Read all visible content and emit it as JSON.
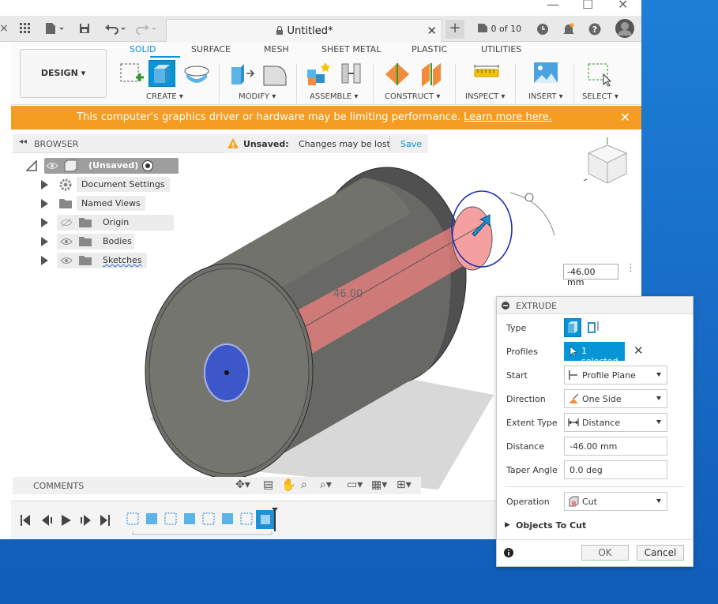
{
  "window": {
    "document_title": "Untitled*",
    "counter": "0 of 10",
    "os_controls": [
      "—",
      "☐",
      "✕"
    ]
  },
  "toolbar": {
    "design_label": "DESIGN ▾",
    "tabs": [
      {
        "label": "SOLID",
        "active": true
      },
      {
        "label": "SURFACE"
      },
      {
        "label": "MESH"
      },
      {
        "label": "SHEET METAL"
      },
      {
        "label": "PLASTIC"
      },
      {
        "label": "UTILITIES"
      }
    ],
    "groups": [
      "CREATE ▾",
      "MODIFY ▾",
      "ASSEMBLE ▾",
      "CONSTRUCT ▾",
      "INSPECT ▾",
      "INSERT ▾",
      "SELECT ▾"
    ]
  },
  "banner": {
    "message": "This computer's graphics driver or hardware may be limiting performance.",
    "link": "Learn more here.",
    "close": "✕"
  },
  "browser": {
    "title": "BROWSER",
    "unsaved_label": "Unsaved:",
    "unsaved_message": "Changes may be lost",
    "save_label": "Save",
    "root": "(Unsaved)",
    "items": [
      {
        "label": "Document Settings",
        "icon": "gear-icon"
      },
      {
        "label": "Named Views",
        "icon": "folder-icon"
      },
      {
        "label": "Origin",
        "icon": "folder-icon",
        "eye": "hidden"
      },
      {
        "label": "Bodies",
        "icon": "folder-icon",
        "eye": "visible"
      },
      {
        "label": "Sketches",
        "icon": "folder-icon",
        "eye": "visible"
      }
    ]
  },
  "viewport": {
    "dimension_label": "46.00",
    "distance_input": "-46.00 mm"
  },
  "extrude": {
    "title": "EXTRUDE",
    "rows": {
      "type_label": "Type",
      "profiles_label": "Profiles",
      "profiles_value": "1 selected",
      "start_label": "Start",
      "start_value": "Profile Plane",
      "direction_label": "Direction",
      "direction_value": "One Side",
      "extent_label": "Extent Type",
      "extent_value": "Distance",
      "distance_label": "Distance",
      "distance_value": "-46.00 mm",
      "taper_label": "Taper Angle",
      "taper_value": "0.0 deg",
      "operation_label": "Operation",
      "operation_value": "Cut",
      "objects_label": "Objects To Cut"
    },
    "ok_label": "OK",
    "cancel_label": "Cancel"
  },
  "comments": {
    "title": "COMMENTS"
  },
  "colors": {
    "accent": "#0696d7",
    "banner": "#f59c23",
    "cut": "#f08080",
    "profile": "#3355cc"
  }
}
